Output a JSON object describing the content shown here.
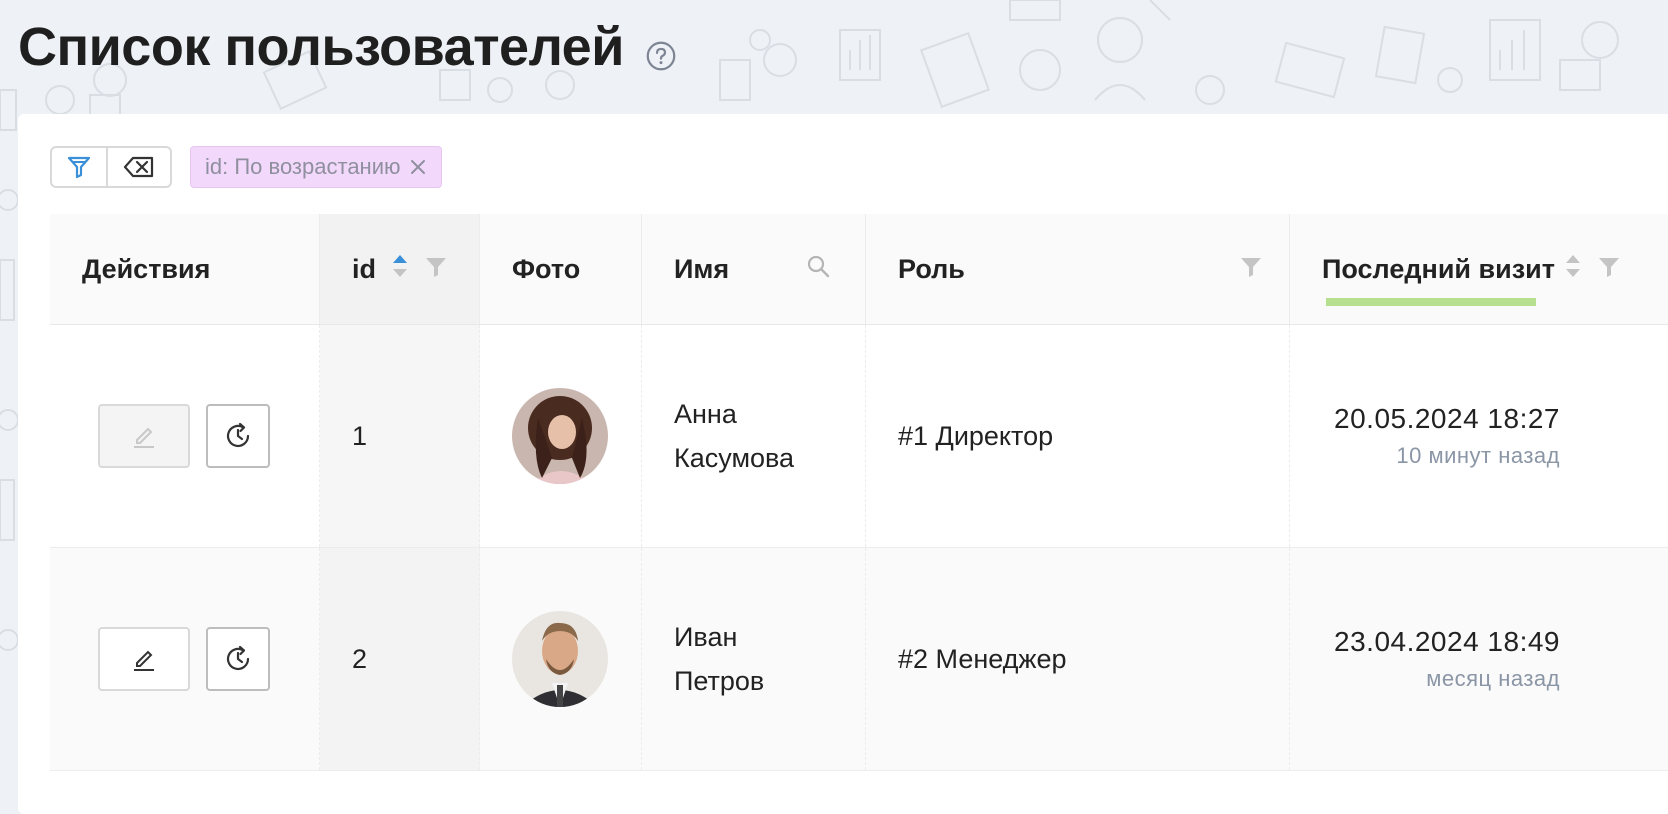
{
  "page": {
    "title": "Список пользователей"
  },
  "toolbar": {
    "filter_button_icon": "filter-icon",
    "clear_button_icon": "clear-filters-icon",
    "chip_label": "id: По возрастанию"
  },
  "table": {
    "columns": [
      {
        "label": "Действия"
      },
      {
        "label": "id"
      },
      {
        "label": "Фото"
      },
      {
        "label": "Имя"
      },
      {
        "label": "Роль"
      },
      {
        "label": "Последний визит"
      }
    ],
    "rows": [
      {
        "id": "1",
        "name_first": "Анна",
        "name_last": "Касумова",
        "role": "#1 Директор",
        "visit_date": "20.05.2024 18:27",
        "visit_relative": "10 минут назад",
        "edit_disabled": true
      },
      {
        "id": "2",
        "name_first": "Иван",
        "name_last": "Петров",
        "role": "#2 Менеджер",
        "visit_date": "23.04.2024 18:49",
        "visit_relative": "месяц назад",
        "edit_disabled": false
      }
    ]
  },
  "colors": {
    "accent_blue": "#3a8fd9",
    "chip_bg": "#f2d9fb",
    "visit_underline": "#b7df90"
  }
}
